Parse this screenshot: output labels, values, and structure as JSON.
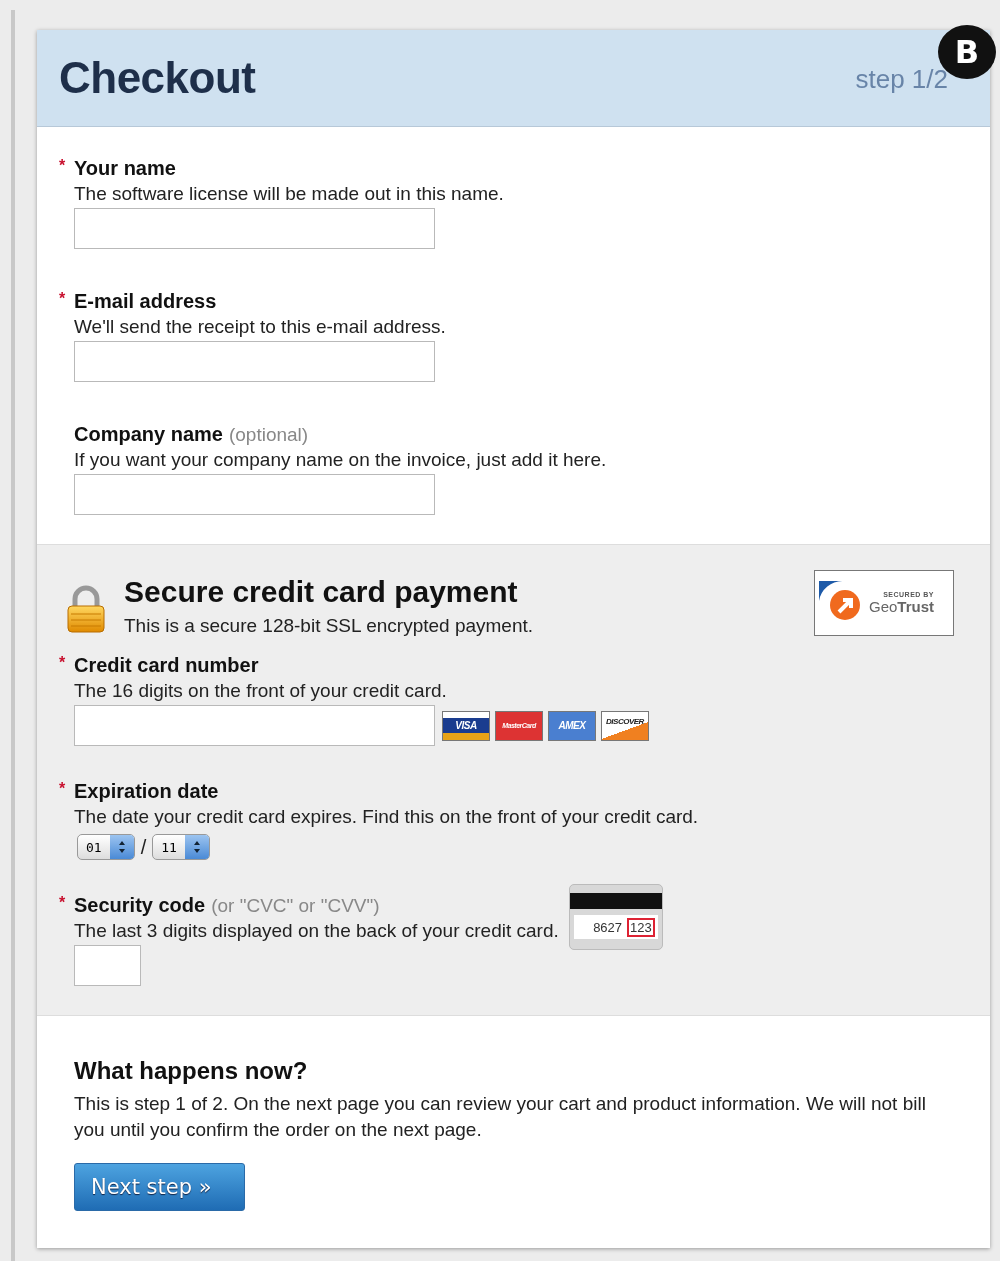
{
  "badge": "B",
  "header": {
    "title": "Checkout",
    "step": "step 1/2"
  },
  "contact_fields": [
    {
      "label": "Your name",
      "required_mark": "*",
      "hint": "The software license will be made out in this name."
    },
    {
      "label": "E-mail address",
      "required_mark": "*",
      "hint": "We'll send the receipt to this e-mail address."
    },
    {
      "label": "Company name",
      "note": "(optional)",
      "hint": "If you want your company name on the invoice, just add it here."
    }
  ],
  "payment": {
    "title": "Secure credit card payment",
    "subtitle": "This is a secure 128-bit SSL encrypted payment.",
    "seal": {
      "caption": "SECURED BY",
      "brand": "Geo**Trust**"
    },
    "fields": [
      {
        "kind": "card_number",
        "label": "Credit card number",
        "required_mark": "*",
        "hint": "The 16 digits on the front of your credit card.",
        "card_logos": [
          "VISA",
          "MasterCard",
          "AMEX",
          "DISCOVER"
        ]
      },
      {
        "kind": "expiry",
        "label": "Expiration date",
        "required_mark": "*",
        "hint": "The date your credit card expires. Find this on the front of your credit card.",
        "selects": [
          "01",
          "11"
        ],
        "separator": "/"
      },
      {
        "kind": "cvc",
        "label": "Security code",
        "note": "(or \"CVC\" or \"CVV\")",
        "required_mark": "*",
        "hint": "The last 3 digits displayed on the back of your credit card.",
        "card_back": {
          "number": "8627",
          "code": "123"
        }
      }
    ]
  },
  "footer": {
    "title": "What happens now?",
    "text": "This is step 1 of 2. On the next page you can review your cart and product information. We will not bill you until you confirm the order on the next page.",
    "button": "Next step »"
  }
}
